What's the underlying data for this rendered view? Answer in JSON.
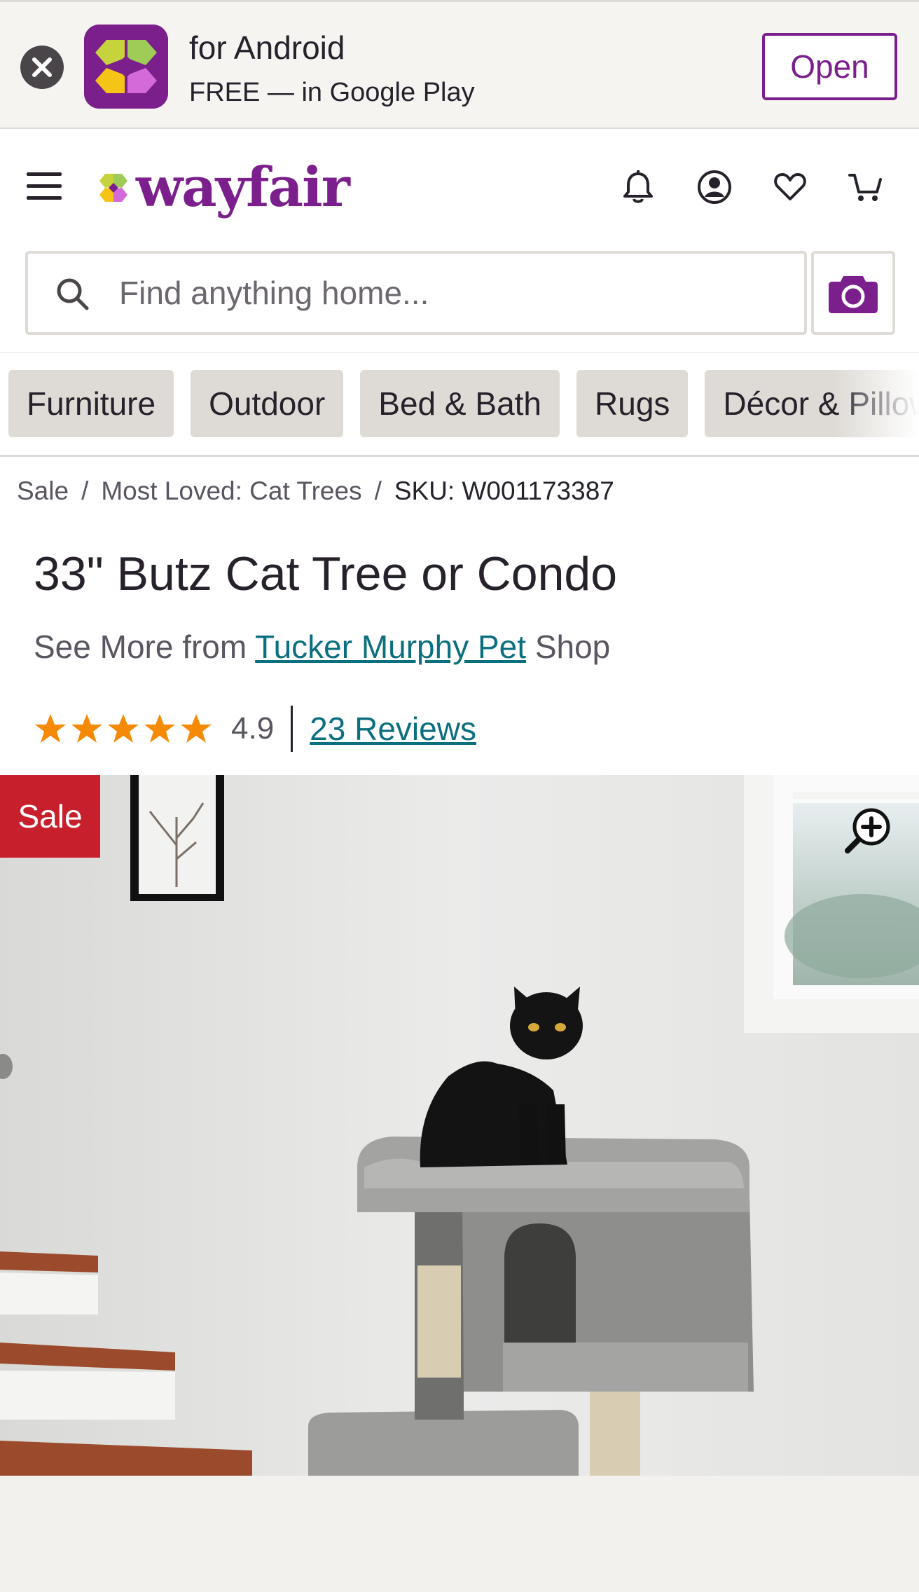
{
  "app_banner": {
    "title": "for Android",
    "subtitle": "FREE — in Google Play",
    "open_label": "Open"
  },
  "header": {
    "logo_text": "wayfair",
    "search": {
      "placeholder": "Find anything home...",
      "value": ""
    }
  },
  "categories": [
    "Furniture",
    "Outdoor",
    "Bed & Bath",
    "Rugs",
    "Décor & Pillows"
  ],
  "breadcrumb": {
    "items": [
      "Sale",
      "Most Loved: Cat Trees"
    ],
    "separator": "/",
    "current": "SKU: W001173387"
  },
  "product": {
    "title": "33\" Butz Cat Tree or Condo",
    "see_more_prefix": "See More from",
    "brand": "Tucker Murphy Pet",
    "see_more_suffix": "Shop",
    "rating": "4.9",
    "stars": 5,
    "reviews_label": "23 Reviews",
    "sale_badge": "Sale"
  },
  "colors": {
    "brand_purple": "#7b1f8c",
    "link_teal": "#0c6f80",
    "star_orange": "#f58a07",
    "sale_red": "#c7202c"
  },
  "icons": [
    "close-icon",
    "menu-icon",
    "bell-icon",
    "account-icon",
    "heart-icon",
    "cart-icon",
    "search-icon",
    "camera-icon",
    "zoom-in-icon",
    "star-icon"
  ]
}
